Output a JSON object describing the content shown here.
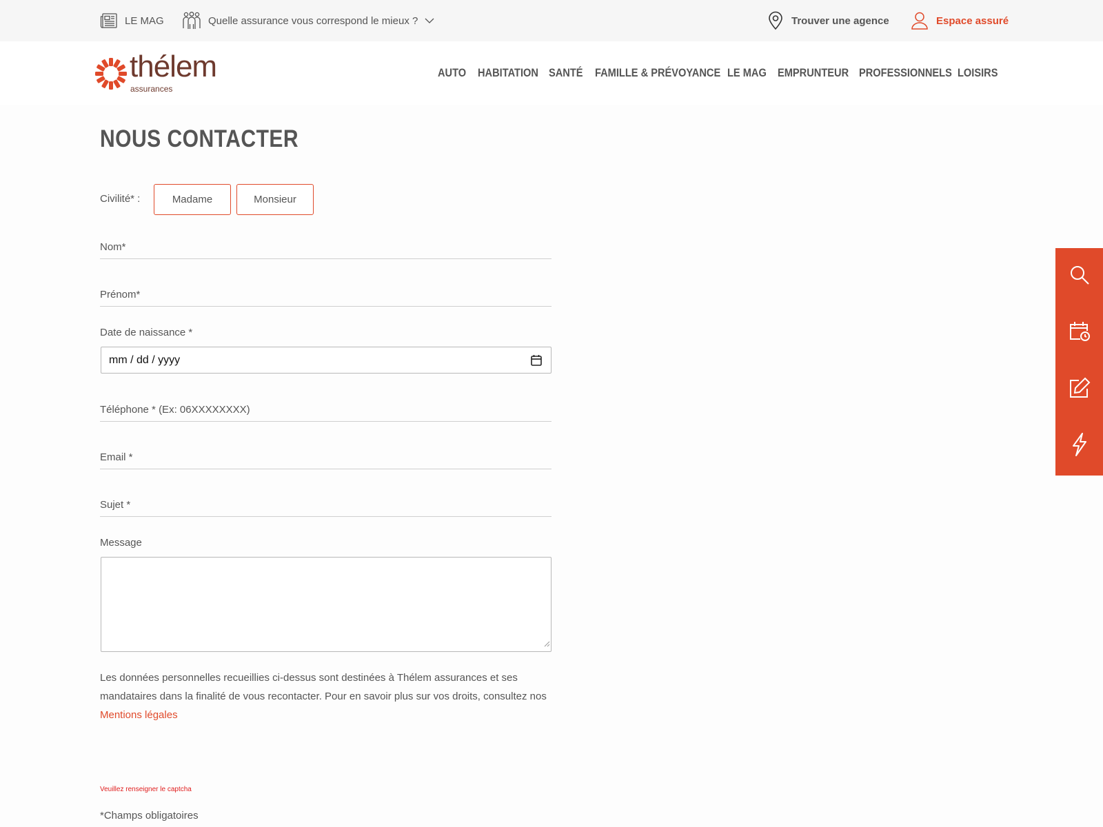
{
  "topbar": {
    "lemag_label": "LE MAG",
    "quelle_label": "Quelle assurance vous correspond le mieux ?",
    "agence_label": "Trouver une agence",
    "espace_label": "Espace assuré"
  },
  "logo": {
    "word": "thélem",
    "sub": "assurances"
  },
  "nav": {
    "items": [
      "AUTO",
      "HABITATION",
      "SANTÉ",
      "FAMILLE & PRÉVOYANCE",
      "LE MAG",
      "EMPRUNTEUR",
      "PROFESSIONNELS",
      "LOISIRS"
    ]
  },
  "page": {
    "title": "NOUS CONTACTER"
  },
  "form": {
    "civilite_label": "Civilité* :",
    "madame": "Madame",
    "monsieur": "Monsieur",
    "nom": "Nom*",
    "prenom": "Prénom*",
    "date_label": "Date de naissance *",
    "date_value": "mm / dd / yyyy",
    "telephone": "Téléphone * (Ex: 06XXXXXXXX)",
    "email": "Email *",
    "sujet": "Sujet *",
    "message_label": "Message",
    "legal_text": "Les données personnelles recueillies ci-dessus sont destinées à Thélem assurances et ses mandataires dans la finalité de vous recontacter. Pour en savoir plus sur vos droits, consultez nos",
    "legal_link": "Mentions légales",
    "captcha_error": "Veuillez renseigner le captcha",
    "required_note": "*Champs obligatoires"
  },
  "colors": {
    "accent": "#e04a2a",
    "logo_brown": "#6e3a2e",
    "topbar_bg": "#f6f6f6"
  },
  "icons": {
    "topbar": [
      "newspaper-icon",
      "people-icon",
      "chevron-down-icon",
      "location-pin-icon",
      "user-icon"
    ],
    "sidebar": [
      "search-icon",
      "calendar-clock-icon",
      "edit-icon",
      "lightning-icon"
    ]
  }
}
